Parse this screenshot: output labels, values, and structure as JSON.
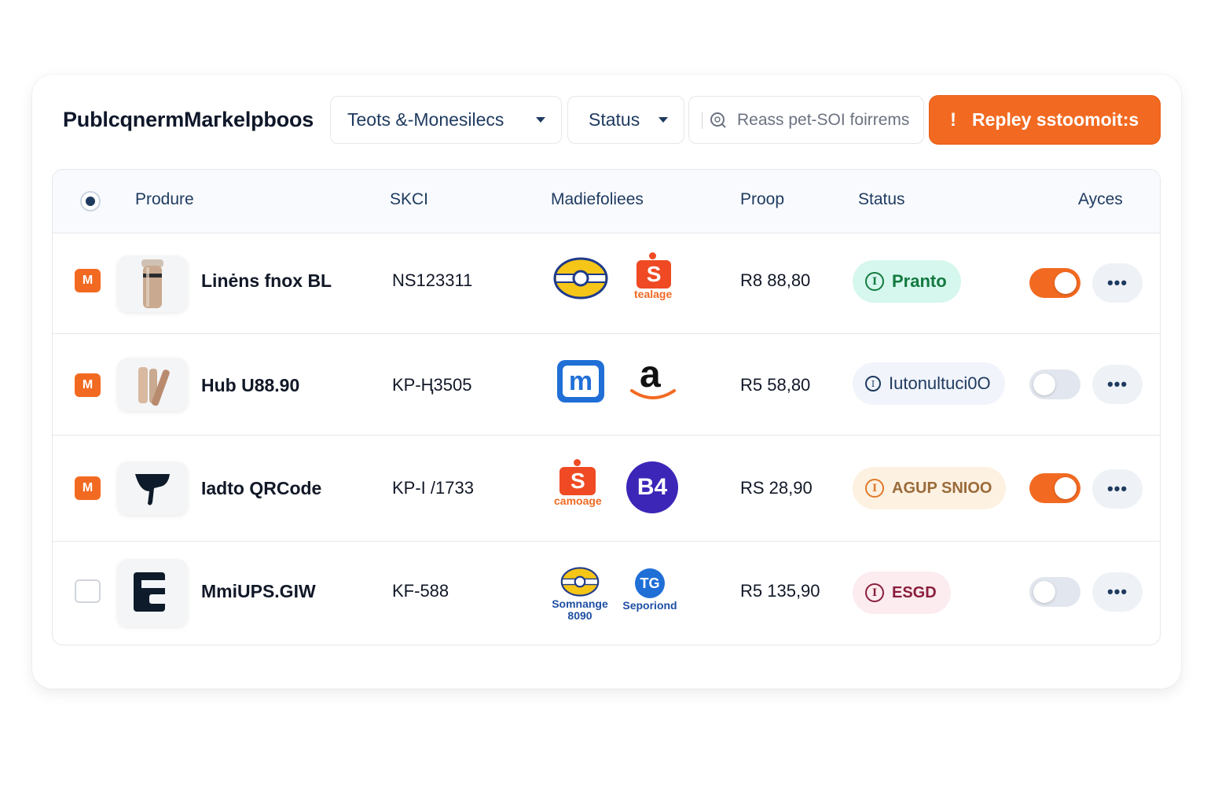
{
  "header": {
    "title": "PublcqnermMaгkelpboos",
    "filter_category": "Teots  &-Monesilecs",
    "filter_status": "Status",
    "search_placeholder": "Reass pet-SOI foirrems",
    "cta_label": "Repley sstoomoit:s"
  },
  "table": {
    "columns": [
      "Produre",
      "SKCI",
      "Madiefoliees",
      "Proop",
      "Status",
      "Ayces"
    ],
    "rows": [
      {
        "selected": true,
        "mark": "M",
        "name": "Linėns fnox BL",
        "sku": "NS123311",
        "markets": [
          {
            "icon": "ring-logo-icon",
            "caption": ""
          },
          {
            "icon": "s-logo-icon",
            "letter": "S",
            "caption": "tealage"
          }
        ],
        "price": "R8 88,80",
        "status": "Pranto",
        "status_color": "#137a3f",
        "status_bg": "#d6f7ee",
        "enabled": true
      },
      {
        "selected": true,
        "mark": "M",
        "name": "Hub U88.90",
        "sku": "KP-Ⱨ3505",
        "markets": [
          {
            "icon": "m-logo-icon",
            "letter": "m",
            "caption": ""
          },
          {
            "icon": "a-logo-icon",
            "letter": "a",
            "caption": ""
          }
        ],
        "price": "R5 58,80",
        "status": "Iutonultuci0O",
        "status_color": "#1e3a5f",
        "status_bg": "#f1f4fb",
        "enabled": false
      },
      {
        "selected": true,
        "mark": "M",
        "name": "Iadto QRCode",
        "sku": "KP-I /1733",
        "markets": [
          {
            "icon": "s-logo-icon",
            "letter": "S",
            "caption": "camoage"
          },
          {
            "icon": "b4-logo-icon",
            "letter": "B4",
            "caption": ""
          }
        ],
        "price": "RS 28,90",
        "status": "AGUP SNIOO",
        "status_color": "#b8742a",
        "status_bg": "#fdf1e2",
        "enabled": true
      },
      {
        "selected": false,
        "mark": "",
        "name": "MmiUPS.GIW",
        "sku": "KF-588",
        "markets": [
          {
            "icon": "ring-logo-icon",
            "caption": "Somnange 8090"
          },
          {
            "icon": "tg-logo-icon",
            "letter": "TG",
            "caption": "Seporiond"
          }
        ],
        "price": "R5 135,90",
        "status": "ESGD",
        "status_color": "#8a1e3d",
        "status_bg": "#fcecef",
        "enabled": false
      }
    ],
    "more_label": "•••"
  },
  "colors": {
    "accent": "#f26a21",
    "text_dark": "#1e3a5f"
  }
}
